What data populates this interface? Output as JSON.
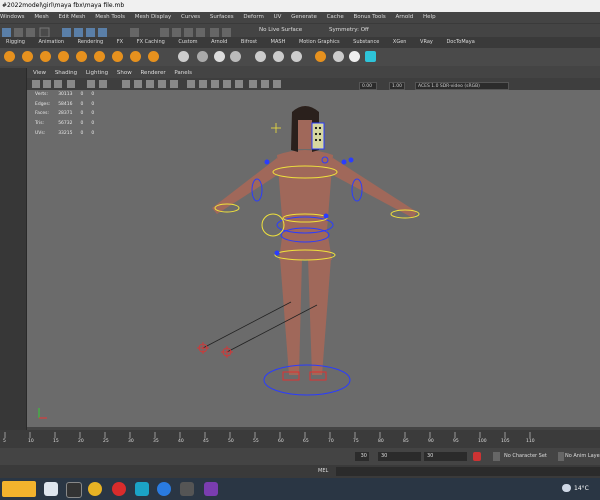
{
  "window": {
    "title": "#2022model\\girl\\maya fbx\\maya file.mb"
  },
  "menubar": {
    "items": [
      "Windows",
      "Mesh",
      "Edit Mesh",
      "Mesh Tools",
      "Mesh Display",
      "Curves",
      "Surfaces",
      "Deform",
      "UV",
      "Generate",
      "Cache",
      "Bonus Tools",
      "Arnold",
      "Help"
    ]
  },
  "status_line": {
    "live_surface": "No Live Surface",
    "symmetry": "Symmetry: Off"
  },
  "shelf": {
    "tabs": [
      "Rigging",
      "Animation",
      "Rendering",
      "FX",
      "FX Caching",
      "Custom",
      "Arnold",
      "Bifrost",
      "MASH",
      "Motion Graphics",
      "Substance",
      "XGen",
      "VRay",
      "DocToMaya"
    ]
  },
  "viewport": {
    "menu": [
      "View",
      "Shading",
      "Lighting",
      "Show",
      "Renderer",
      "Panels"
    ],
    "exposure": "0.00",
    "gamma": "1.00",
    "color_space": "ACES 1.0 SDR-video (sRGB)",
    "hud": [
      {
        "label": "Verts:",
        "v1": "30113",
        "v2": "0",
        "v3": "0"
      },
      {
        "label": "Edges:",
        "v1": "58416",
        "v2": "0",
        "v3": "0"
      },
      {
        "label": "Faces:",
        "v1": "28371",
        "v2": "0",
        "v3": "0"
      },
      {
        "label": "Tris:",
        "v1": "56732",
        "v2": "0",
        "v3": "0"
      },
      {
        "label": "UVs:",
        "v1": "33215",
        "v2": "0",
        "v3": "0"
      }
    ]
  },
  "time_slider": {
    "ticks": [
      "5",
      "10",
      "15",
      "20",
      "25",
      "30",
      "35",
      "40",
      "45",
      "50",
      "55",
      "60",
      "65",
      "70",
      "75",
      "80",
      "85",
      "90",
      "95",
      "100",
      "105",
      "110"
    ]
  },
  "range_slider": {
    "start_field": "30",
    "range_start": "30",
    "range_end": "30",
    "character_set": "No Character Set",
    "anim_layer": "No Anim Layer"
  },
  "command_line": {
    "label": "MEL"
  },
  "taskbar": {
    "temperature": "14°C"
  },
  "colors": {
    "viewport_bg": "#6b6b6b",
    "shelf_icon": "#e6911e",
    "taskbar": "#2a3644",
    "rig_blue": "#2a3cff",
    "rig_yellow": "#f0e23c",
    "rig_red": "#e03030"
  }
}
